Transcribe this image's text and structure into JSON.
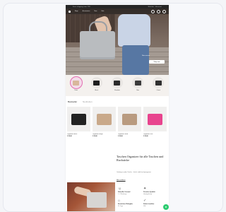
{
  "topbar": {
    "left_text": "Free shipping over €99",
    "right_text": "Wishlist · Account"
  },
  "nav": {
    "items": [
      "Bags",
      "Accessories",
      "New",
      "Sale"
    ]
  },
  "hero": {
    "headline": "New season",
    "cta": "Shop now"
  },
  "categories": [
    {
      "label": "Totes",
      "color": "#d8b79b",
      "active": true
    },
    {
      "label": "Black",
      "color": "#1e1e1e",
      "active": false
    },
    {
      "label": "Shoulder",
      "color": "#2b2b2b",
      "active": false
    },
    {
      "label": "Mini",
      "color": "#3a3a3a",
      "active": false
    },
    {
      "label": "Clutch",
      "color": "#2f2f2f",
      "active": false
    }
  ],
  "section": {
    "title": "Bestseller",
    "subtitle": "Neuheiten"
  },
  "products": [
    {
      "name": "Organizer Black",
      "price": "€ 29,90",
      "color": "#222222"
    },
    {
      "name": "Organizer Beige",
      "price": "€ 29,90",
      "color": "#c9a98a"
    },
    {
      "name": "Organizer Sand",
      "price": "€ 29,90",
      "color": "#b99b80"
    },
    {
      "name": "Organizer Pink",
      "price": "€ 29,90",
      "color": "#e8448e"
    }
  ],
  "editorial": {
    "title": "Taschen Organizer für alle Taschen und Rucksäcke",
    "body": "Ordnung in jeder Tasche – leicht, stabil und passgenau.",
    "link": "Mehr erfahren"
  },
  "features": [
    {
      "icon": "☺",
      "title": "Schneller Versand",
      "desc": "1–3 Werktage"
    },
    {
      "icon": "✦",
      "title": "Premium Qualität",
      "desc": "Handgefertigt"
    },
    {
      "icon": "⌂",
      "title": "Kostenlose Rückgabe",
      "desc": "30 Tage"
    },
    {
      "icon": "✓",
      "title": "Sicher bezahlen",
      "desc": "SSL"
    }
  ],
  "chat": {
    "icon": "●"
  }
}
